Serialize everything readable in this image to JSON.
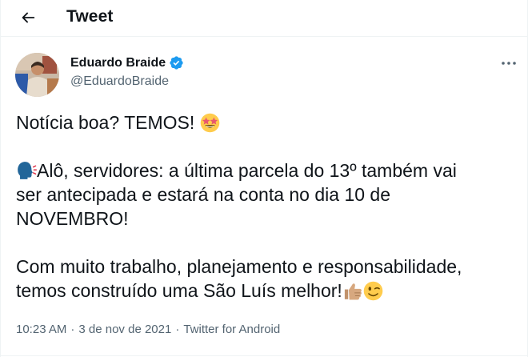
{
  "header": {
    "back_icon": "arrow-left-icon",
    "title": "Tweet"
  },
  "author": {
    "name": "Eduardo Braide",
    "handle": "@EduardoBraide",
    "verified_icon": "verified-badge-icon",
    "more_icon": "more-horizontal-icon"
  },
  "tweet": {
    "line1": "Notícia boa? TEMOS!",
    "line2": "Alô, servidores: a última parcela do 13º também vai",
    "line3": "ser antecipada e estará na conta no dia 10 de",
    "line4": "NOVEMBRO!",
    "line5": "Com muito trabalho, planejamento e responsabilidade,",
    "line6": "temos construído uma São Luís melhor!",
    "emojis": [
      "star-struck-emoji",
      "speaking-head-emoji",
      "thumbs-up-emoji",
      "winking-face-emoji"
    ]
  },
  "meta": {
    "time": "10:23 AM",
    "separator": "·",
    "date": "3 de nov de 2021",
    "source": "Twitter for Android"
  },
  "colors": {
    "text": "#0f1419",
    "secondary": "#536471",
    "verified_blue": "#1d9bf0",
    "divider": "#eff3f4"
  }
}
